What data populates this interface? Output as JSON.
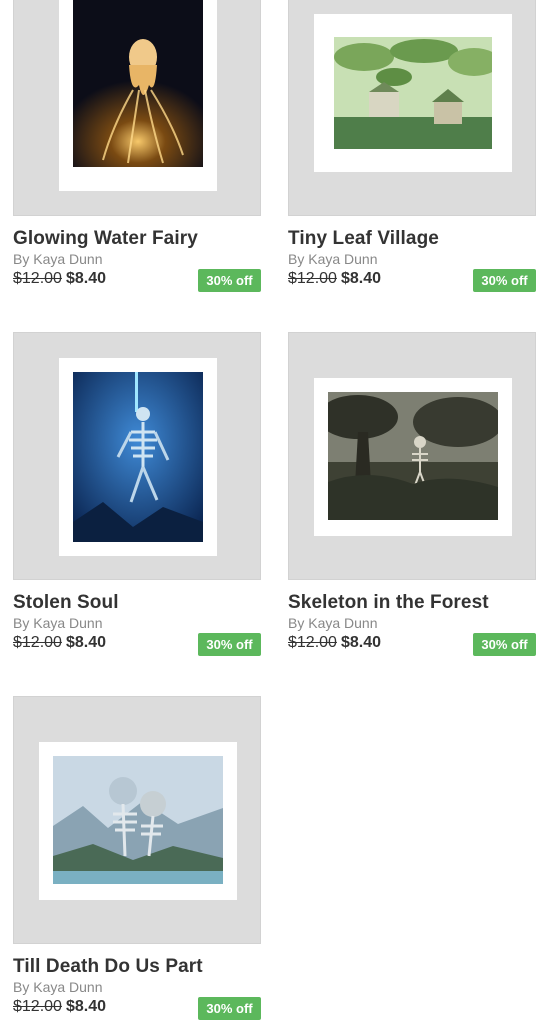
{
  "products": [
    {
      "title": "Glowing Water Fairy",
      "artist": "By Kaya Dunn",
      "old_price": "$12.00",
      "new_price": "$8.40",
      "discount": "30% off"
    },
    {
      "title": "Tiny Leaf Village",
      "artist": "By Kaya Dunn",
      "old_price": "$12.00",
      "new_price": "$8.40",
      "discount": "30% off"
    },
    {
      "title": "Stolen Soul",
      "artist": "By Kaya Dunn",
      "old_price": "$12.00",
      "new_price": "$8.40",
      "discount": "30% off"
    },
    {
      "title": "Skeleton in the Forest",
      "artist": "By Kaya Dunn",
      "old_price": "$12.00",
      "new_price": "$8.40",
      "discount": "30% off"
    },
    {
      "title": "Till Death Do Us Part",
      "artist": "By Kaya Dunn",
      "old_price": "$12.00",
      "new_price": "$8.40",
      "discount": "30% off"
    }
  ],
  "colors": {
    "badge": "#5cb85c",
    "frame": "#dcdcdc",
    "text": "#333333",
    "muted": "#888888"
  }
}
